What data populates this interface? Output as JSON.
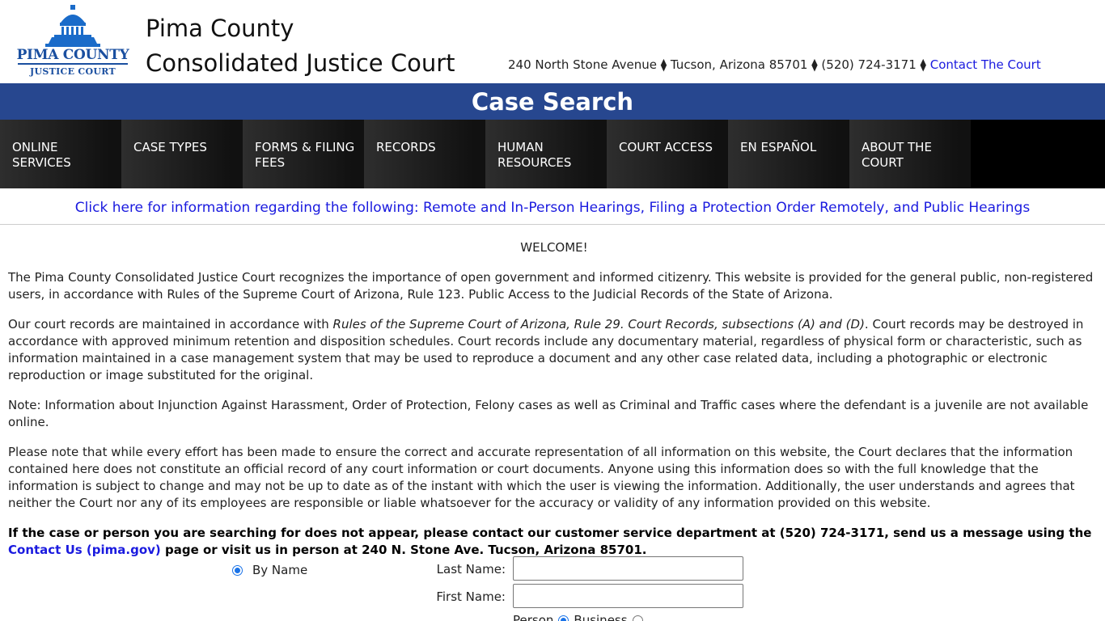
{
  "header": {
    "logo_line1": "PIMA COUNTY",
    "logo_line2": "JUSTICE COURT",
    "court_name_line1": "Pima County",
    "court_name_line2": "Consolidated Justice Court",
    "address": "240 North Stone Avenue",
    "city": "Tucson, Arizona 85701",
    "phone": "(520) 724-3171",
    "separator": "⧫",
    "contact_link": "Contact The Court"
  },
  "page_title": "Case Search",
  "nav": {
    "items": [
      {
        "label": "ONLINE SERVICES"
      },
      {
        "label": "CASE TYPES"
      },
      {
        "label": "FORMS & FILING FEES"
      },
      {
        "label": "RECORDS"
      },
      {
        "label": "HUMAN RESOURCES"
      },
      {
        "label": "COURT ACCESS"
      },
      {
        "label": "EN ESPAÑOL"
      },
      {
        "label": "ABOUT THE COURT"
      }
    ]
  },
  "notice_link": "Click here for information regarding the following: Remote and In-Person Hearings, Filing a Protection Order Remotely, and Public Hearings",
  "content": {
    "welcome": "WELCOME!",
    "para1": "The Pima County Consolidated Justice Court recognizes the importance of open government and informed citizenry. This website is provided for the general public, non-registered users, in accordance with Rules of the Supreme Court of Arizona, Rule 123. Public Access to the Judicial Records of the State of Arizona.",
    "para2_before": "Our court records are maintained in accordance with ",
    "para2_italic": "Rules of the Supreme Court of Arizona, Rule 29. Court Records, subsections (A) and (D)",
    "para2_after": ". Court records may be destroyed in accordance with approved minimum retention and disposition schedules. Court records include any documentary material, regardless of physical form or characteristic, such as information maintained in a case management system that may be used to reproduce a document and any other case related data, including a photographic or electronic reproduction or image substituted for the original.",
    "para3": "Note: Information about Injunction Against Harassment, Order of Protection, Felony cases as well as Criminal and Traffic cases where the defendant is a juvenile are not available online.",
    "para4": "Please note that while every effort has been made to ensure the correct and accurate representation of all information on this website, the Court declares that the information contained here does not constitute an official record of any court information or court documents. Anyone using this information does so with the full knowledge that the information is subject to change and may not be up to date as of the instant with which the user is viewing the information. Additionally, the user understands and agrees that neither the Court nor any of its employees are responsible or liable whatsoever for the accuracy or validity of any information provided on this website.",
    "para5_before": "If the case or person you are searching for does not appear, please contact our customer service department at (520) 724-3171, send us a message using the ",
    "para5_link": "Contact Us (pima.gov)",
    "para5_after": " page or visit us in person at 240 N. Stone Ave. Tucson, Arizona 85701."
  },
  "search_form": {
    "by_name_label": "By Name",
    "by_name_selected": true,
    "last_name_label": "Last Name:",
    "last_name_value": "",
    "first_name_label": "First Name:",
    "first_name_value": "",
    "type_person_label": "Person",
    "type_business_label": "Business",
    "type_selected": "Person"
  },
  "colors": {
    "title_bar": "#27478f",
    "link": "#1a1adf",
    "logo": "#1a4fa0"
  }
}
